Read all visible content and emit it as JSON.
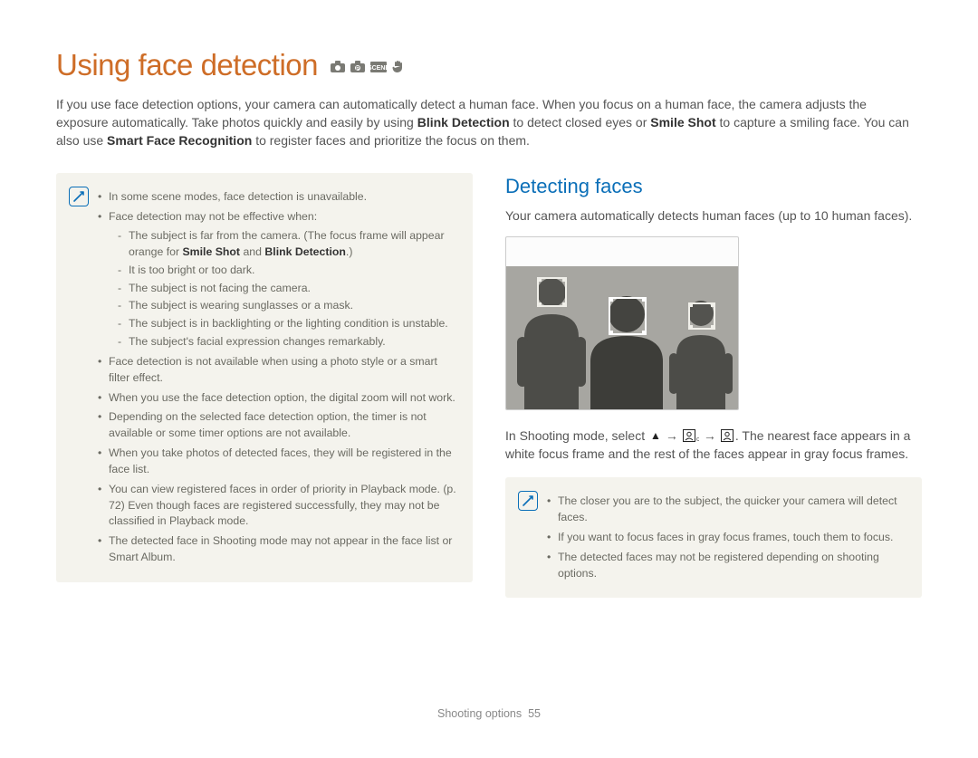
{
  "title": "Using face detection",
  "intro": "If you use face detection options, your camera can automatically detect a human face. When you focus on a human face, the camera adjusts the exposure automatically. Take photos quickly and easily by using <b>Blink Detection</b> to detect closed eyes or <b>Smile Shot</b> to capture a smiling face. You can also use <b>Smart Face Recognition</b> to register faces and prioritize the focus on them.",
  "left_notes": {
    "items": [
      "In some scene modes, face detection is unavailable.",
      "Face detection may not be effective when:",
      "Face detection is not available when using a photo style or a smart filter effect.",
      "When you use the face detection option, the digital zoom will not work.",
      "Depending on the selected face detection option, the timer is not available or some timer options are not available.",
      "When you take photos of detected faces, they will be registered in the face list.",
      "You can view registered faces in order of priority in Playback mode. (p. 72)  Even though faces are registered successfully, they may not be classified in Playback mode.",
      "The detected face in Shooting mode may not appear in the face list or Smart Album."
    ],
    "sub": [
      "The subject is far from the camera. (The focus frame will appear orange for <b>Smile Shot</b> and <b>Blink Detection</b>.)",
      "It is too bright or too dark.",
      "The subject is not facing the camera.",
      "The subject is wearing sunglasses or a mask.",
      "The subject is in backlighting or the lighting condition is unstable.",
      "The subject's facial expression changes remarkably."
    ]
  },
  "right": {
    "heading": "Detecting faces",
    "intro": "Your camera automatically detects human faces (up to 10 human faces).",
    "instruction_pre": "In Shooting mode, select ",
    "instruction_post": ". The nearest face appears in a white focus frame and the rest of the faces appear in gray focus frames.",
    "notes": [
      "The closer you are to the subject, the quicker your camera will detect faces.",
      "If you want to focus faces in gray focus frames, touch them to focus.",
      "The detected faces may not be registered depending on shooting options."
    ]
  },
  "footer": {
    "section": "Shooting options",
    "page": "55"
  }
}
